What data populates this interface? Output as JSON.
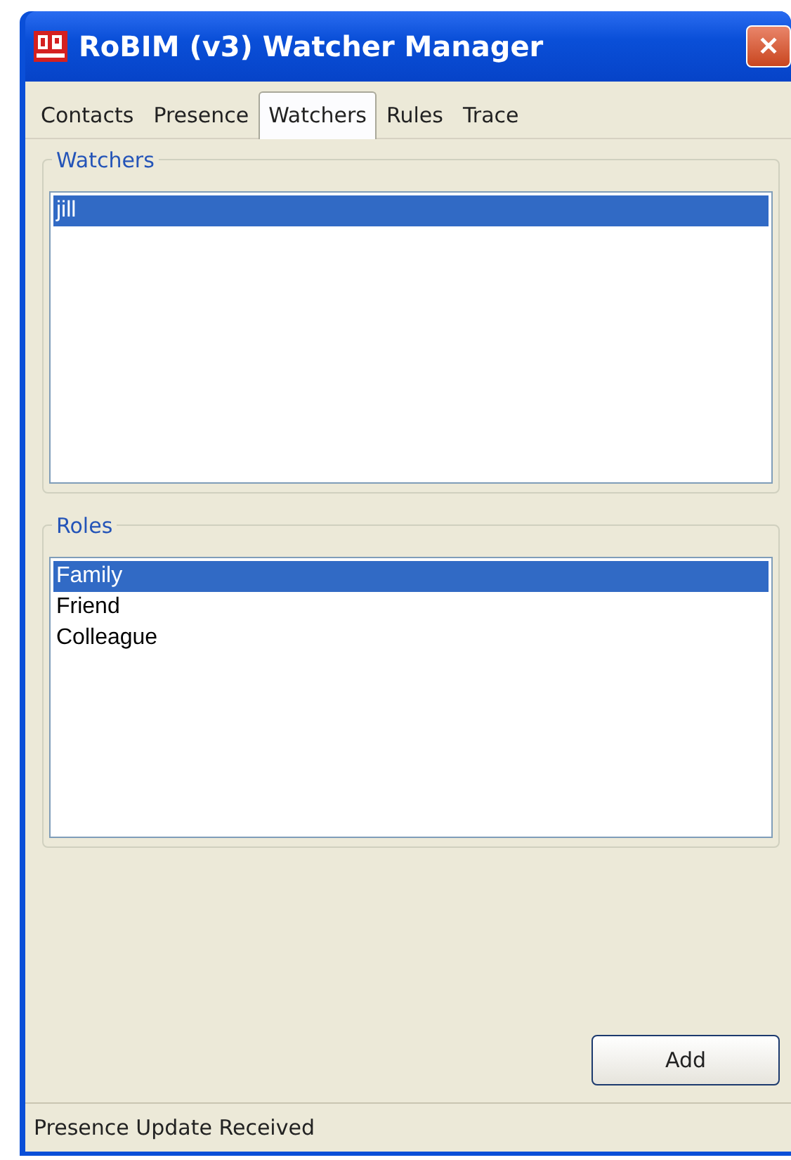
{
  "window": {
    "title": "RoBIM (v3) Watcher Manager",
    "close": "✕"
  },
  "tabs": [
    {
      "label": "Contacts",
      "selected": false
    },
    {
      "label": "Presence",
      "selected": false
    },
    {
      "label": "Watchers",
      "selected": true
    },
    {
      "label": "Rules",
      "selected": false
    },
    {
      "label": "Trace",
      "selected": false
    }
  ],
  "watchers": {
    "legend": "Watchers",
    "items": [
      {
        "label": "jill",
        "selected": true
      }
    ]
  },
  "roles": {
    "legend": "Roles",
    "items": [
      {
        "label": "Family",
        "selected": true
      },
      {
        "label": "Friend",
        "selected": false
      },
      {
        "label": "Colleague",
        "selected": false
      }
    ]
  },
  "buttons": [
    "Add"
  ],
  "status_bar": "Presence Update Received"
}
